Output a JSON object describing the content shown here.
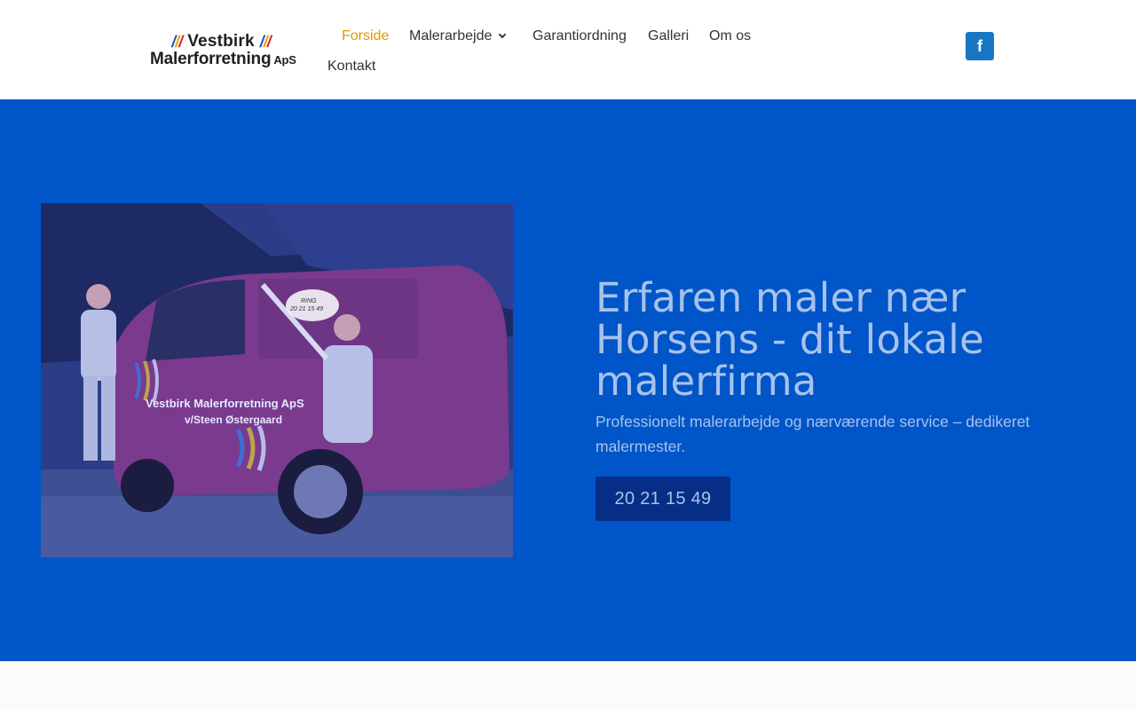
{
  "brand": {
    "name_line1": "Vestbirk",
    "name_line2": "Malerforretning",
    "suffix": "ApS",
    "slash_colors": [
      "#1e4fb5",
      "#e8a300",
      "#d22828"
    ]
  },
  "nav": {
    "items": [
      {
        "label": "Forside",
        "active": true
      },
      {
        "label": "Malerarbejde",
        "has_dropdown": true
      },
      {
        "label": "Garantiordning"
      },
      {
        "label": "Galleri"
      },
      {
        "label": "Om os"
      },
      {
        "label": "Kontakt"
      }
    ],
    "active_color": "#e09900"
  },
  "social": {
    "facebook_label": "f",
    "icon": "facebook-icon"
  },
  "hero": {
    "title": "Erfaren maler nær Horsens - dit lokale malerfirma",
    "subtitle": "Professionelt malerarbejde og nærværende service – dedikeret malermester.",
    "cta_label": "20 21 15 49",
    "background_color": "#0055c8",
    "photo": {
      "van_text_line1": "Vestbirk Malerforretning ApS",
      "van_text_line2": "v/Steen Østergaard",
      "bubble_label": "RING",
      "bubble_number": "20 21 15 49"
    }
  }
}
